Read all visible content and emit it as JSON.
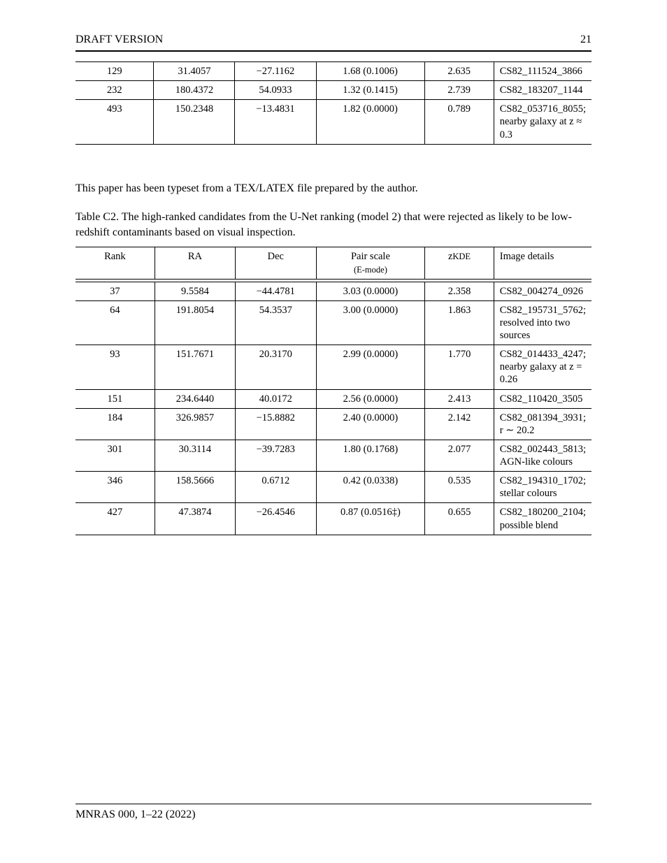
{
  "header": {
    "left": "DRAFT VERSION",
    "right": "21"
  },
  "footer": {
    "left": "MNRAS 000, 1–22 (2022)"
  },
  "chart_data": [
    {
      "type": "table",
      "title": "Table A (continued ranking rows)",
      "columns": [
        "Rank",
        "RA",
        "Dec",
        "Pair scale (E-mode)",
        "z_KDE",
        "Image details"
      ],
      "rows": [
        {
          "rank": "129",
          "ra": "31.4057",
          "dec": "−27.1162",
          "pair": "1.68 (0.1006)",
          "z": "2.635",
          "details": "CS82_111524_3866"
        },
        {
          "rank": "232",
          "ra": "180.4372",
          "dec": "54.0933",
          "pair": "1.32 (0.1415)",
          "z": "2.739",
          "details": "CS82_183207_1144"
        },
        {
          "rank": "493",
          "ra": "150.2348",
          "dec": "−13.4831",
          "pair": "1.82 (0.0000)",
          "z": "0.789",
          "details": "CS82_053716_8055; nearby galaxy at z ≈ 0.3"
        }
      ]
    },
    {
      "type": "table",
      "title": "Table C2. The high-ranked candidates from the U-Net ranking (model 2) that were rejected as likely to be low-redshift contaminants based on visual inspection.",
      "columns": [
        "Rank",
        "RA",
        "Dec",
        "Pair scale (E-mode)",
        "z_KDE",
        "Image details"
      ],
      "rows": [
        {
          "rank": "37",
          "ra": "9.5584",
          "dec": "−44.4781",
          "pair": "3.03 (0.0000)",
          "z": "2.358",
          "details": "CS82_004274_0926"
        },
        {
          "rank": "64",
          "ra": "191.8054",
          "dec": "54.3537",
          "pair": "3.00 (0.0000)",
          "z": "1.863",
          "details": "CS82_195731_5762; resolved into two sources"
        },
        {
          "rank": "93",
          "ra": "151.7671",
          "dec": "20.3170",
          "pair": "2.99 (0.0000)",
          "z": "1.770",
          "details": "CS82_014433_4247; nearby galaxy at z = 0.26"
        },
        {
          "rank": "151",
          "ra": "234.6440",
          "dec": "40.0172",
          "pair": "2.56 (0.0000)",
          "z": "2.413",
          "details": "CS82_110420_3505"
        },
        {
          "rank": "184",
          "ra": "326.9857",
          "dec": "−15.8882",
          "pair": "2.40 (0.0000)",
          "z": "2.142",
          "details": "CS82_081394_3931; r ∼ 20.2"
        },
        {
          "rank": "301",
          "ra": "30.3114",
          "dec": "−39.7283",
          "pair": "1.80 (0.1768)",
          "z": "2.077",
          "details": "CS82_002443_5813; AGN-like colours"
        },
        {
          "rank": "346",
          "ra": "158.5666",
          "dec": "0.6712",
          "pair": "0.42 (0.0338)",
          "z": "0.535",
          "details": "CS82_194310_1702; stellar colours"
        },
        {
          "rank": "427",
          "ra": "47.3874",
          "dec": "−26.4546",
          "pair": "0.87 (0.0516‡)",
          "z": "0.655",
          "details": "CS82_180200_2104; possible blend"
        }
      ]
    }
  ],
  "captions": {
    "between": "This paper has been typeset from a TEX/LATEX file prepared by the author.",
    "tableC2": "Table C2. The high-ranked candidates from the U-Net ranking (model 2) that were rejected as likely to be low-redshift contaminants based on visual inspection."
  },
  "columnHeaders": {
    "rank": "Rank",
    "ra": "RA",
    "dec": "Dec",
    "pair": "Pair scale",
    "pair2": "(E-mode)",
    "z": "z",
    "zsub": "KDE",
    "details": "Image details"
  }
}
